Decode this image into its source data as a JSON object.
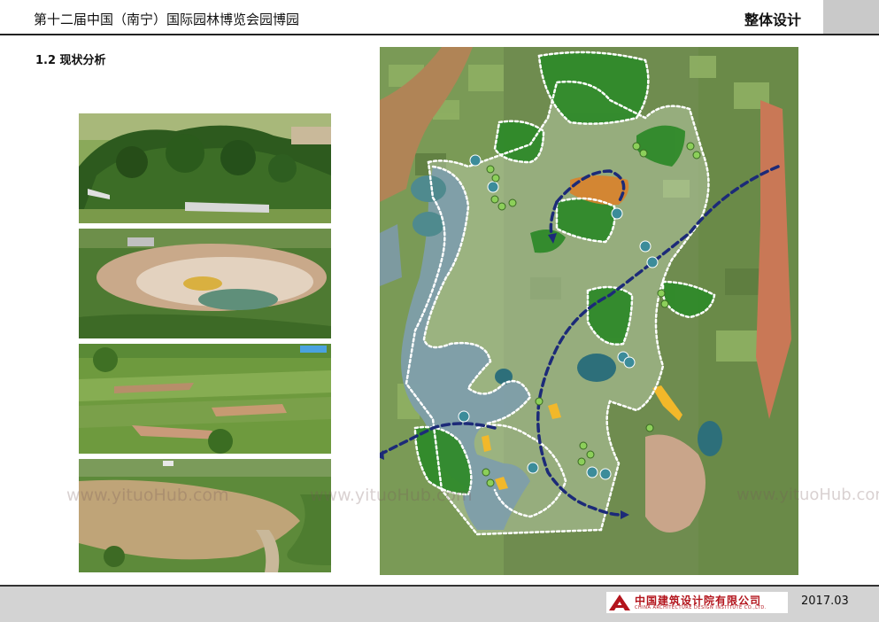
{
  "header": {
    "title": "第十二届中国（南宁）国际园林博览会园博园",
    "section": "整体设计"
  },
  "subtitle": "1.2 现状分析",
  "footer": {
    "company_cn": "中国建筑设计院有限公司",
    "company_en": "CHINA ARCHITECTURE DESIGN INSTITUTE CO.,LTD.",
    "date": "2017.03"
  },
  "watermark": "www.yituoHub.com",
  "colors": {
    "route": "#1c2a78",
    "boundary": "#ffffff",
    "forest": "#2f8a2a",
    "water_point": "#3c8c9a",
    "green_point": "#8ccf5a",
    "yellow_area": "#f2b82a",
    "orange_area": "#d9822b",
    "logo_red": "#b3141c"
  },
  "photos": [
    "forest-hill-photo",
    "quarry-pit-photo",
    "terraced-farmland-photo",
    "muddy-pond-photo"
  ]
}
